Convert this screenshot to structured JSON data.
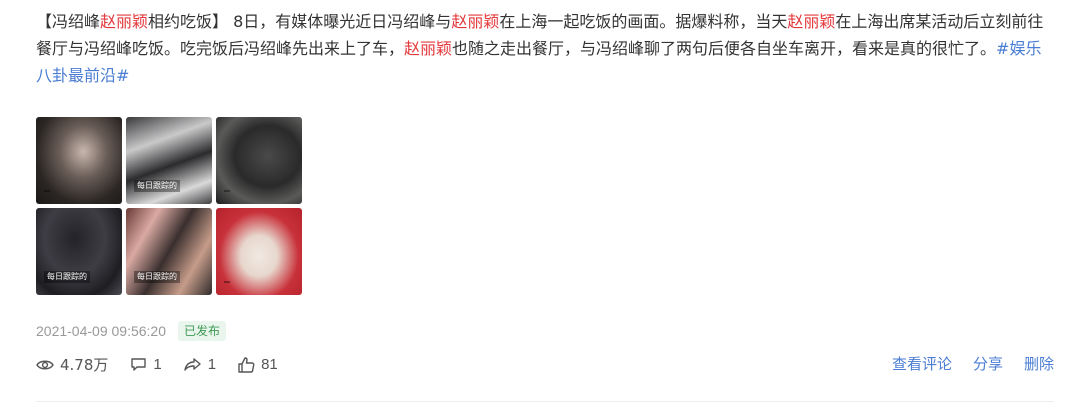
{
  "post": {
    "segments": [
      {
        "text": "【冯绍峰",
        "style": "normal"
      },
      {
        "text": "赵丽颖",
        "style": "highlight"
      },
      {
        "text": "相约吃饭】 8日，有媒体曝光近日冯绍峰与",
        "style": "normal"
      },
      {
        "text": "赵丽颖",
        "style": "highlight"
      },
      {
        "text": "在上海一起吃饭的画面。据爆料称，当天",
        "style": "normal"
      },
      {
        "text": "赵丽颖",
        "style": "highlight"
      },
      {
        "text": "在上海出席某活动后立刻前往餐厅与冯绍峰吃饭。吃完饭后冯绍峰先出来上了车，",
        "style": "normal"
      },
      {
        "text": "赵丽颖",
        "style": "highlight"
      },
      {
        "text": "也随之走出餐厅，与冯绍峰聊了两句后便各自坐车离开，看来是真的很忙了。",
        "style": "normal"
      },
      {
        "text": "#娱乐八卦最前沿#",
        "style": "topic"
      }
    ]
  },
  "images": [
    {
      "caption": ""
    },
    {
      "caption": "每日跟踪的"
    },
    {
      "caption": ""
    },
    {
      "caption": "每日跟踪的"
    },
    {
      "caption": "每日跟踪的"
    },
    {
      "caption": ""
    }
  ],
  "meta": {
    "timestamp": "2021-04-09 09:56:20",
    "status": "已发布"
  },
  "stats": {
    "views": "4.78万",
    "comments": "1",
    "shares": "1",
    "likes": "81"
  },
  "actions": {
    "view_comments": "查看评论",
    "share": "分享",
    "delete": "删除"
  },
  "colors": {
    "highlight": "#e4393c",
    "link": "#4a7dd3",
    "status_text": "#3e9a55",
    "status_bg": "#eaf6ed"
  },
  "icons": {
    "views": "eye-icon",
    "comments": "comment-icon",
    "shares": "share-icon",
    "likes": "thumbs-up-icon"
  }
}
